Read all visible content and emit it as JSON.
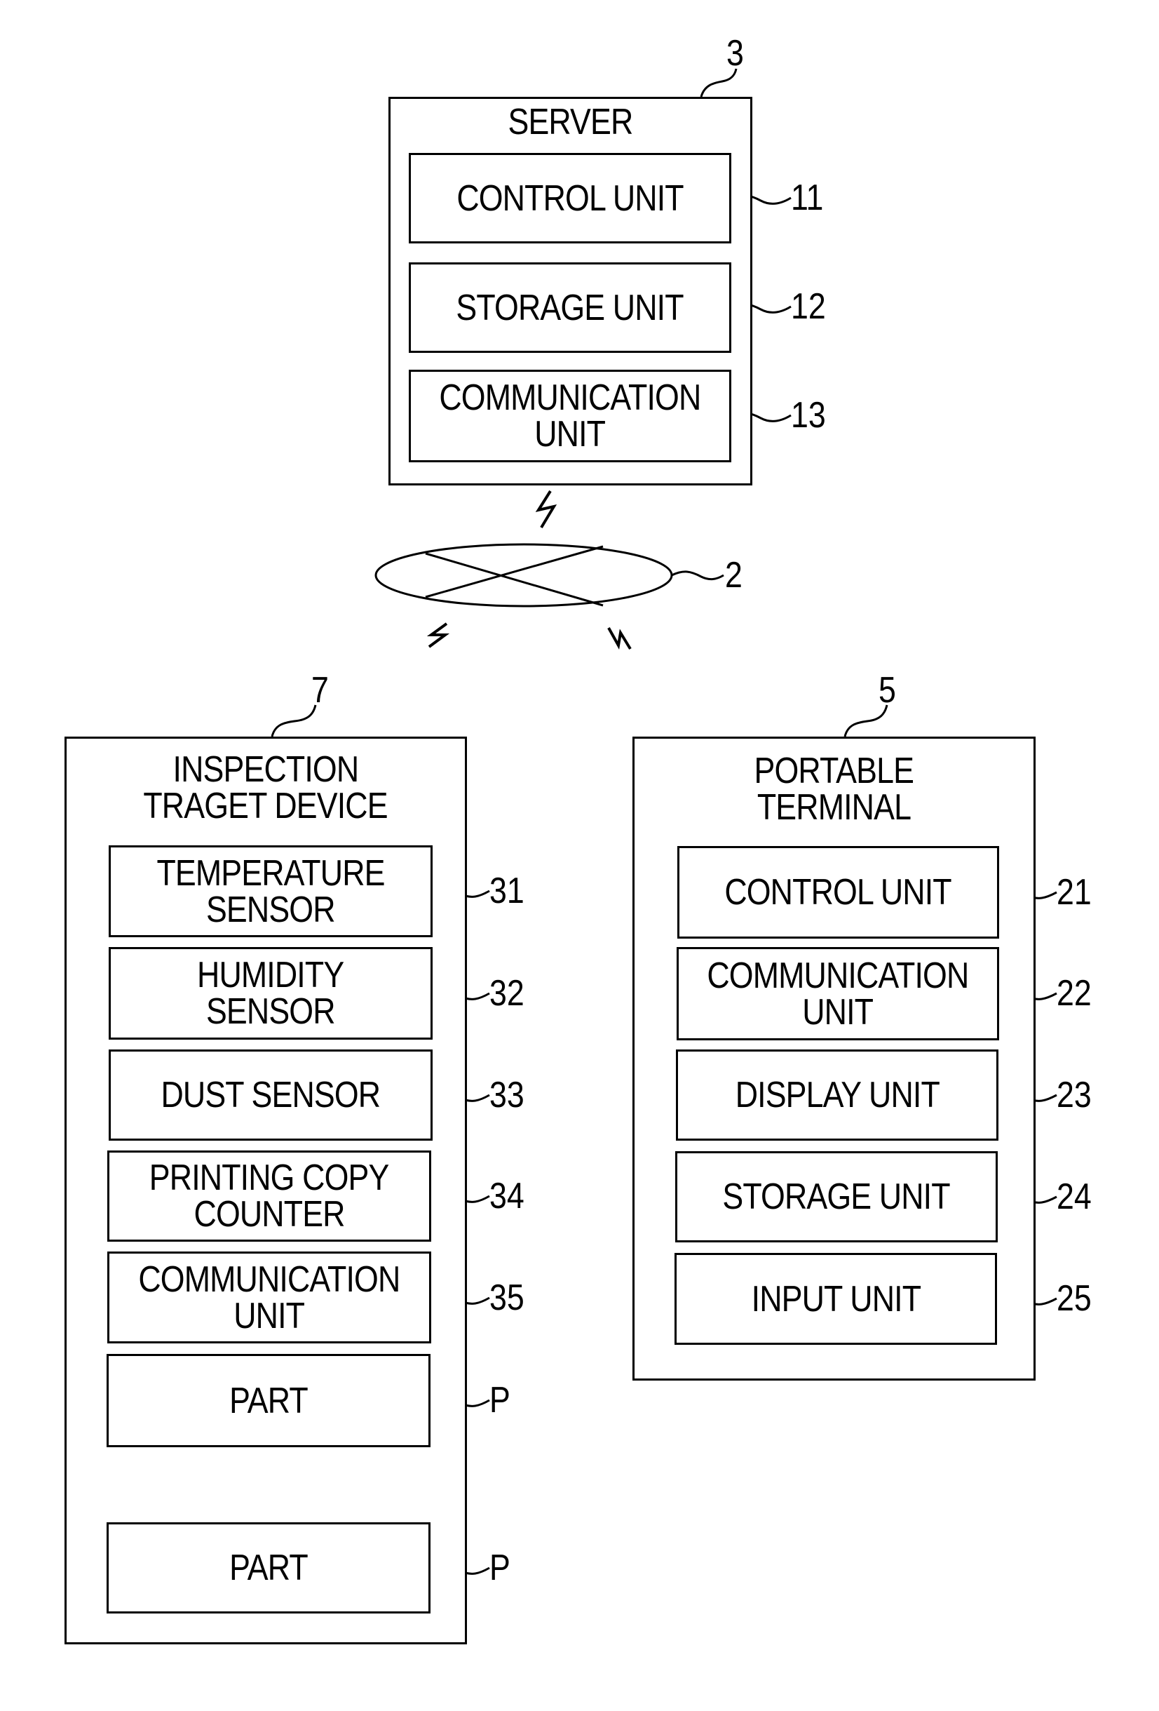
{
  "server": {
    "ref": "3",
    "title": "SERVER",
    "units": [
      {
        "label": "CONTROL UNIT",
        "ref": "11"
      },
      {
        "label": "STORAGE UNIT",
        "ref": "12"
      },
      {
        "label": "COMMUNICATION UNIT",
        "line1": "COMMUNICATION",
        "line2": "UNIT",
        "ref": "13"
      }
    ]
  },
  "network": {
    "ref": "2"
  },
  "inspection_device": {
    "ref": "7",
    "title_line1": "INSPECTION",
    "title_line2": "TRAGET DEVICE",
    "units": [
      {
        "line1": "TEMPERATURE",
        "line2": "SENSOR",
        "ref": "31"
      },
      {
        "line1": "HUMIDITY",
        "line2": "SENSOR",
        "ref": "32"
      },
      {
        "label": "DUST SENSOR",
        "ref": "33"
      },
      {
        "line1": "PRINTING COPY",
        "line2": "COUNTER",
        "ref": "34"
      },
      {
        "line1": "COMMUNICATION",
        "line2": "UNIT",
        "ref": "35"
      },
      {
        "label": "PART",
        "ref": "P"
      },
      {
        "label": "PART",
        "ref": "P"
      }
    ]
  },
  "portable_terminal": {
    "ref": "5",
    "title_line1": "PORTABLE",
    "title_line2": "TERMINAL",
    "units": [
      {
        "label": "CONTROL UNIT",
        "ref": "21"
      },
      {
        "line1": "COMMUNICATION",
        "line2": "UNIT",
        "ref": "22"
      },
      {
        "label": "DISPLAY UNIT",
        "ref": "23"
      },
      {
        "label": "STORAGE UNIT",
        "ref": "24"
      },
      {
        "label": "INPUT UNIT",
        "ref": "25"
      }
    ]
  }
}
